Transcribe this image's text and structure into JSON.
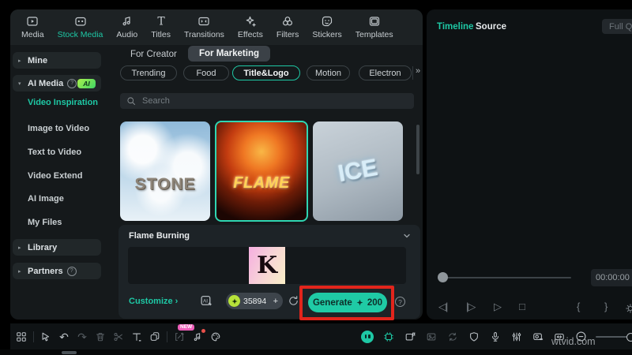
{
  "window": {
    "watermark": "wtvid.com"
  },
  "toolbar": {
    "tabs": [
      {
        "label": "Media"
      },
      {
        "label": "Stock Media",
        "active": true
      },
      {
        "label": "Audio"
      },
      {
        "label": "Titles"
      },
      {
        "label": "Transitions"
      },
      {
        "label": "Effects"
      },
      {
        "label": "Filters"
      },
      {
        "label": "Stickers"
      },
      {
        "label": "Templates"
      }
    ]
  },
  "sidebar": {
    "groups": [
      {
        "label": "Mine"
      },
      {
        "label": "AI Media",
        "badge": "AI",
        "has_help": true
      },
      {
        "label": "Library"
      },
      {
        "label": "Partners",
        "has_help": true
      }
    ],
    "items": [
      {
        "label": "Video Inspiration",
        "active": true
      },
      {
        "label": "Image to Video"
      },
      {
        "label": "Text to Video"
      },
      {
        "label": "Video Extend"
      },
      {
        "label": "AI Image"
      },
      {
        "label": "My Files"
      }
    ],
    "help_glyph": "?",
    "collapsed_arrow": "▸",
    "expanded_arrow": "▾"
  },
  "browser": {
    "audience_tabs": [
      {
        "label": "For Creator"
      },
      {
        "label": "For Marketing",
        "active": true
      }
    ],
    "categories": [
      {
        "label": "Trending"
      },
      {
        "label": "Food"
      },
      {
        "label": "Title&Logo",
        "active": true
      },
      {
        "label": "Motion"
      },
      {
        "label": "Electron"
      }
    ],
    "more_glyph": "»",
    "search": {
      "placeholder": "Search"
    },
    "templates": [
      {
        "title": "STONE"
      },
      {
        "title": "FLAME",
        "selected": true
      },
      {
        "title": "ICE"
      }
    ]
  },
  "detail": {
    "title": "Flame Burning",
    "preview_letter": "K",
    "customize_label": "Customize ›",
    "credits": "35894",
    "add_glyph": "+",
    "generate_label": "Generate",
    "generate_cost": "200",
    "help_glyph": "?"
  },
  "preview": {
    "tabs": [
      {
        "label": "Timeline",
        "active": true
      },
      {
        "label": "Source"
      }
    ],
    "quality_label": "Full Qu",
    "timecode": "00:00:00",
    "transport": {
      "prev_frame": "◁|",
      "step_forward": "|▷",
      "play": "▷",
      "stop": "□",
      "mark_in": "{",
      "mark_out": "}"
    }
  },
  "bottombar": {
    "new_badge": "NEW",
    "undo_glyph": "↶",
    "redo_glyph": "↷"
  },
  "colors": {
    "accent": "#1ec8a5",
    "annotation": "#e2251c",
    "new_badge": "#ed5fb9",
    "credits_green": "#b7e23a"
  }
}
